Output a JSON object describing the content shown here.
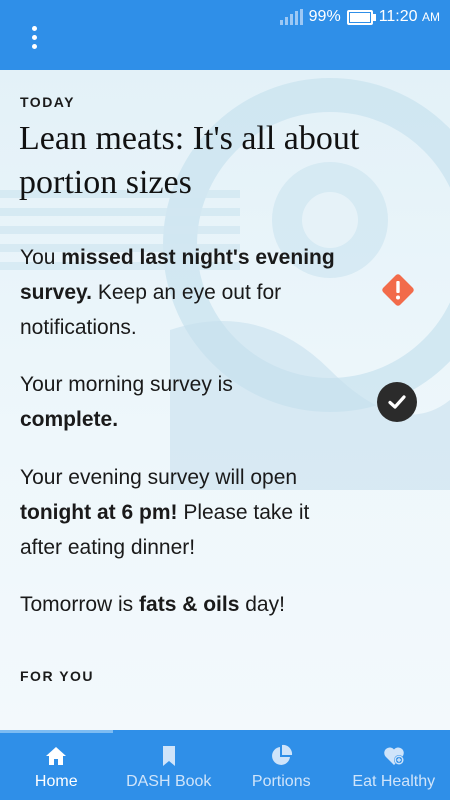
{
  "status_bar": {
    "battery": "99%",
    "time": "11:20",
    "ampm": "AM"
  },
  "app_bar": {
    "menu_icon": "more-vert-icon"
  },
  "today": {
    "label": "TODAY",
    "headline": "Lean meats: It's all about portion sizes",
    "messages": [
      {
        "parts": [
          "You ",
          "missed last night's evening survey.",
          " Keep an eye out for notifications."
        ],
        "icon": "warning-icon"
      },
      {
        "parts": [
          "Your morning survey is ",
          "complete.",
          ""
        ],
        "icon": "check-icon"
      },
      {
        "parts": [
          "Your evening survey will open ",
          "tonight at 6 pm!",
          " Please take it after eating dinner!"
        ]
      },
      {
        "parts": [
          "Tomorrow is ",
          "fats & oils",
          " day!"
        ]
      }
    ]
  },
  "for_you": {
    "label": "FOR YOU"
  },
  "bottom_nav": {
    "items": [
      {
        "label": "Home",
        "icon": "home-icon",
        "active": true
      },
      {
        "label": "DASH Book",
        "icon": "bookmark-icon",
        "active": false
      },
      {
        "label": "Portions",
        "icon": "pie-chart-icon",
        "active": false
      },
      {
        "label": "Eat Healthy",
        "icon": "heart-plus-icon",
        "active": false
      }
    ]
  },
  "colors": {
    "primary": "#2f8fe8",
    "warning": "#f26b4a",
    "check_bg": "#2b2b2b"
  }
}
